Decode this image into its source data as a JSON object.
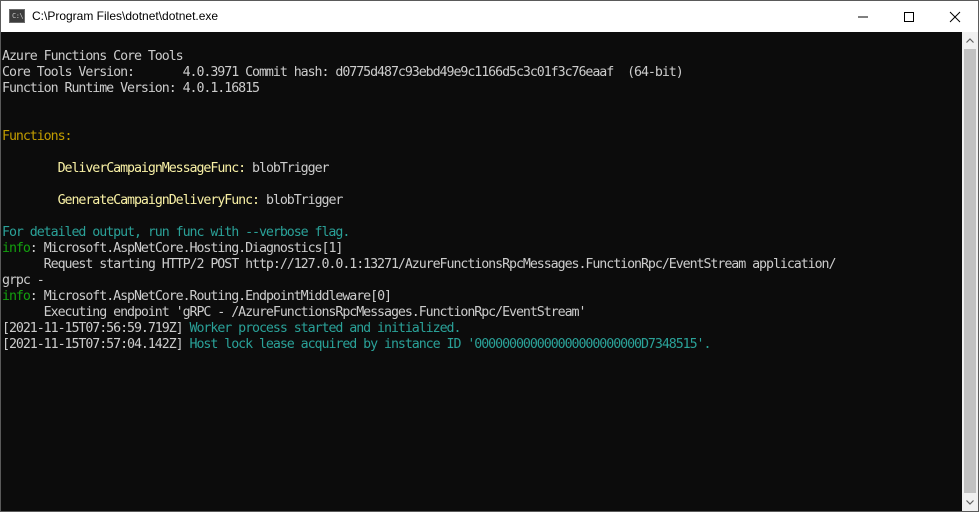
{
  "window": {
    "title": "C:\\Program Files\\dotnet\\dotnet.exe",
    "icon_glyph": "C:\\",
    "icon": "console-app-icon",
    "controls": [
      "minimize-icon",
      "maximize-icon",
      "close-icon"
    ]
  },
  "colors": {
    "background": "#0c0c0c",
    "default_text": "#cccccc",
    "functions_header": "#c19c00",
    "function_name": "#f9f1a5",
    "info_tag": "#13a10e",
    "message": "#3a96dd"
  },
  "console": {
    "lines": [
      {
        "segments": [
          {
            "text": "Azure Functions Core Tools",
            "style": "gray"
          }
        ]
      },
      {
        "segments": [
          {
            "text": "Core Tools Version:       4.0.3971 Commit hash: d0775d487c93ebd49e9c1166d5c3c01f3c76eaaf  (64-bit)",
            "style": "gray"
          }
        ]
      },
      {
        "segments": [
          {
            "text": "Function Runtime Version: 4.0.1.16815",
            "style": "gray"
          }
        ]
      },
      {
        "segments": []
      },
      {
        "segments": []
      },
      {
        "segments": [
          {
            "text": "Functions:",
            "style": "olive"
          }
        ]
      },
      {
        "segments": []
      },
      {
        "segments": [
          {
            "text": "        ",
            "style": "gray"
          },
          {
            "text": "DeliverCampaignMessageFunc:",
            "style": "yellow"
          },
          {
            "text": " blobTrigger",
            "style": "gray"
          }
        ]
      },
      {
        "segments": []
      },
      {
        "segments": [
          {
            "text": "        ",
            "style": "gray"
          },
          {
            "text": "GenerateCampaignDeliveryFunc:",
            "style": "yellow"
          },
          {
            "text": " blobTrigger",
            "style": "gray"
          }
        ]
      },
      {
        "segments": []
      },
      {
        "segments": [
          {
            "text": "For detailed output, run func with --verbose flag.",
            "style": "cyan"
          }
        ]
      },
      {
        "segments": [
          {
            "text": "info",
            "style": "green"
          },
          {
            "text": ": Microsoft.AspNetCore.Hosting.Diagnostics[1]",
            "style": "gray"
          }
        ]
      },
      {
        "segments": [
          {
            "text": "      Request starting HTTP/2 POST http://127.0.0.1:13271/AzureFunctionsRpcMessages.FunctionRpc/EventStream application/",
            "style": "gray"
          }
        ]
      },
      {
        "segments": [
          {
            "text": "grpc -",
            "style": "gray"
          }
        ]
      },
      {
        "segments": [
          {
            "text": "info",
            "style": "green"
          },
          {
            "text": ": Microsoft.AspNetCore.Routing.EndpointMiddleware[0]",
            "style": "gray"
          }
        ]
      },
      {
        "segments": [
          {
            "text": "      Executing endpoint 'gRPC - /AzureFunctionsRpcMessages.FunctionRpc/EventStream'",
            "style": "gray"
          }
        ]
      },
      {
        "segments": [
          {
            "text": "[2021-11-15T07:56:59.719Z] ",
            "style": "gray"
          },
          {
            "text": "Worker process started and initialized.",
            "style": "cyan"
          }
        ]
      },
      {
        "segments": [
          {
            "text": "[2021-11-15T07:57:04.142Z] ",
            "style": "gray"
          },
          {
            "text": "Host lock lease acquired by instance ID '000000000000000000000000D7348515'.",
            "style": "cyan"
          }
        ]
      }
    ]
  },
  "scrollbar": {
    "icons": [
      "scroll-up-arrow-icon",
      "scroll-down-arrow-icon"
    ],
    "position": 0
  }
}
